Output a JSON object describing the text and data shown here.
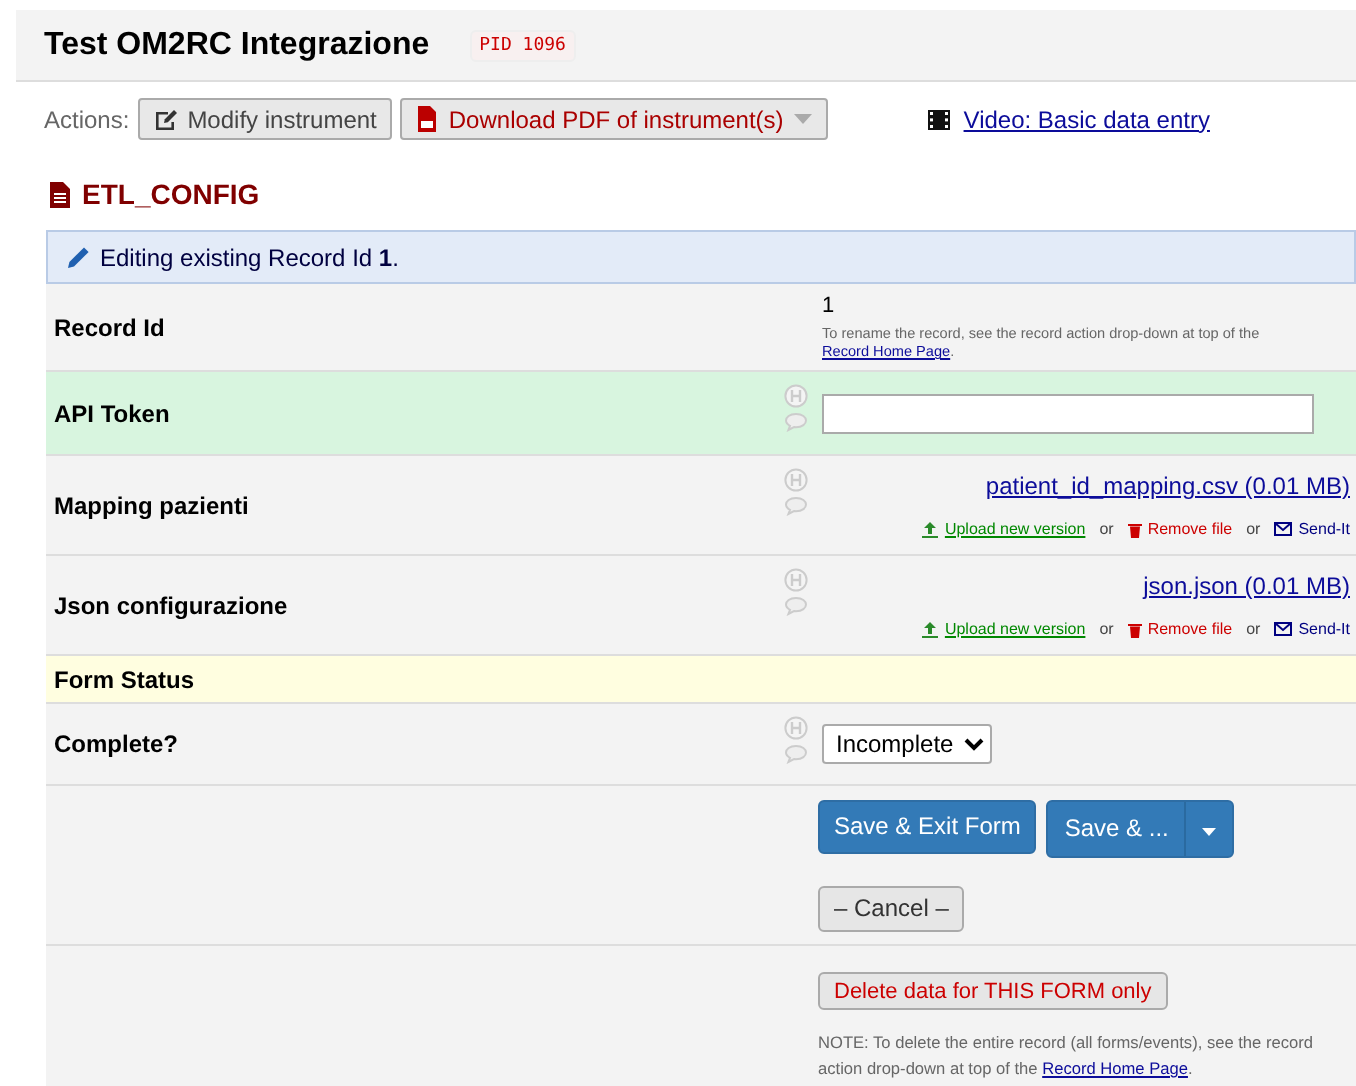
{
  "project": {
    "title": "Test OM2RC Integrazione",
    "pid": "PID 1096"
  },
  "actions": {
    "label": "Actions:",
    "buttons": [
      {
        "label": "Modify instrument",
        "kind": "modify"
      },
      {
        "label": "Download PDF of instrument(s)",
        "kind": "pdf"
      }
    ],
    "video_link": "Video: Basic data entry"
  },
  "instrument": {
    "name": "ETL_CONFIG"
  },
  "banner": {
    "text": "Editing existing Record Id **1**."
  },
  "fields": [
    {
      "kind": "text",
      "label": "Record Id",
      "focused": false,
      "value": "1",
      "note": "To rename the record, see the record action drop-down at top of the",
      "note_link": "Record Home Page",
      "note_end": "."
    },
    {
      "kind": "input",
      "label": "API Token",
      "focused": true
    },
    {
      "kind": "file",
      "label": "Mapping pazienti",
      "focused": false,
      "file": "patient_id_mapping.csv (0.01 MB)",
      "links": [
        {
          "kind": "upload",
          "label": "Upload new version"
        },
        {
          "kind": "remove",
          "label": "Remove file"
        },
        {
          "kind": "send",
          "label": "Send-It"
        }
      ],
      "separators": [
        "or",
        "or"
      ]
    },
    {
      "kind": "file",
      "label": "Json configurazione",
      "focused": false,
      "file": "json.json (0.01 MB)",
      "links": [
        {
          "kind": "upload",
          "label": "Upload new version"
        },
        {
          "kind": "remove",
          "label": "Remove file"
        },
        {
          "kind": "send",
          "label": "Send-It"
        }
      ],
      "separators": [
        "or",
        "or"
      ]
    },
    {
      "kind": "header",
      "label": "Form Status"
    },
    {
      "kind": "select",
      "label": "Complete?",
      "focused": false,
      "value": "Incomplete"
    }
  ],
  "save": {
    "buttons": [
      {
        "kind": "primary",
        "label": "Save & Exit Form"
      },
      {
        "kind": "split",
        "label": "Save & ..."
      }
    ],
    "cancel": "– Cancel –"
  },
  "delete": {
    "button": "Delete data for THIS FORM only",
    "note": "NOTE: To delete the entire record (all forms/events), see the record action drop-down at top of the",
    "note_link": "Record Home Page",
    "note_end": "."
  }
}
